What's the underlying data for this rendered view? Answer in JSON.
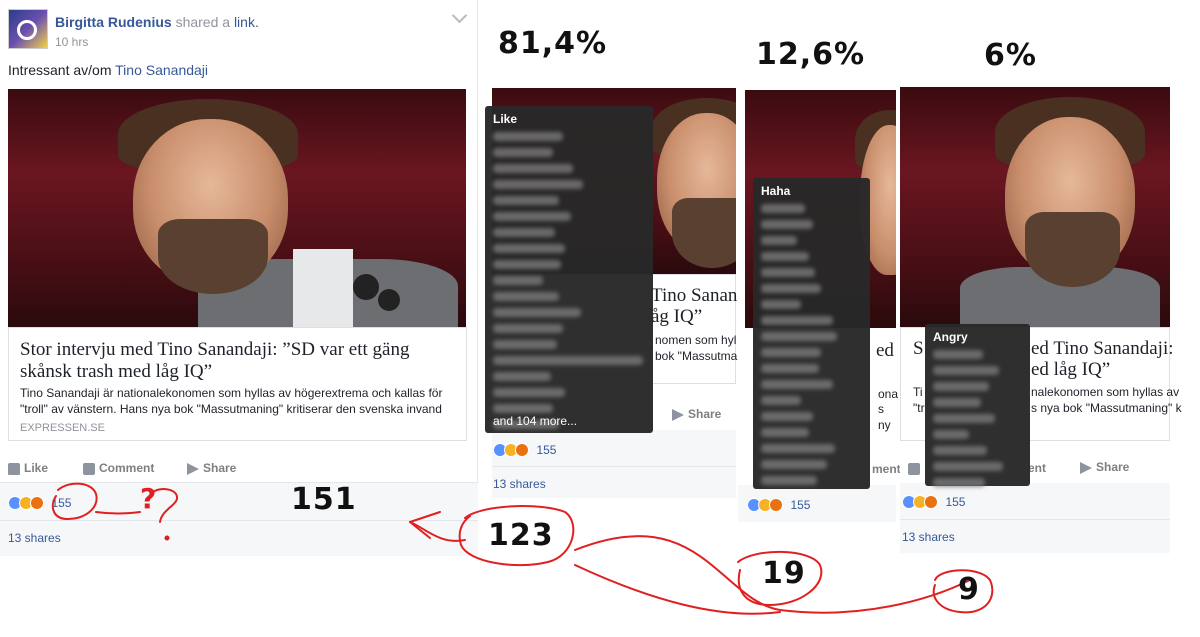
{
  "post": {
    "author": "Birgitta Rudenius",
    "action_text": "shared a",
    "action_link": "link.",
    "time": "10 hrs",
    "body_prefix": "Intressant av/om",
    "body_link": "Tino Sanandaji",
    "link_title": "Stor intervju med Tino Sanandaji: ”SD var ett gäng skånsk trash med låg IQ”",
    "link_desc": "Tino Sanandaji är nationalekonomen som hyllas av högerextrema och kallas för \"troll\" av vänstern. Hans nya bok \"Massutmaning\" kritiserar den svenska invand",
    "link_domain": "EXPRESSEN.SE",
    "actions": {
      "like": "Like",
      "comment": "Comment",
      "share": "Share"
    },
    "reaction_count": "155",
    "shares": "13 shares"
  },
  "panels": {
    "like": {
      "percent": "81,4%",
      "header": "Like",
      "more": "and 104 more...",
      "title_fragment1": "Tino Sanand",
      "title_fragment2": "åg IQ”",
      "desc_fragment1": "nomen som hyl",
      "desc_fragment2": "bok \"Massutmanin",
      "share": "Share",
      "reaction_count": "155",
      "shares": "13 shares"
    },
    "haha": {
      "percent": "12,6%",
      "header": "Haha",
      "title_fragment": "ed",
      "desc_fragment1": "ona",
      "desc_fragment2": "s ny",
      "comment_fragment": "ment",
      "reaction_count": "155"
    },
    "angry": {
      "percent": "6%",
      "header": "Angry",
      "title_fragment1": "ed Tino Sanandaji:",
      "title_fragment2": "ed låg IQ”",
      "desc_fragment1": "nalekonomen som hyllas av",
      "desc_fragment2": "s nya bok \"Massutmaning\" k",
      "comment_fragment": "ent",
      "share": "Share",
      "reaction_count": "155",
      "shares": "13 shares",
      "left_fragment1": "Ti",
      "left_fragment2": "\"tr"
    }
  },
  "annotations": {
    "question": "?",
    "total": "151",
    "like_count": "123",
    "haha_count": "19",
    "angry_count": "9"
  },
  "colors": {
    "link": "#365899",
    "annotation": "#e02020",
    "tooltip": "#282828"
  },
  "icons": [
    "avatar",
    "chevron-down-icon",
    "like-icon",
    "comment-icon",
    "share-icon",
    "like-reaction-icon",
    "haha-reaction-icon",
    "angry-reaction-icon"
  ]
}
